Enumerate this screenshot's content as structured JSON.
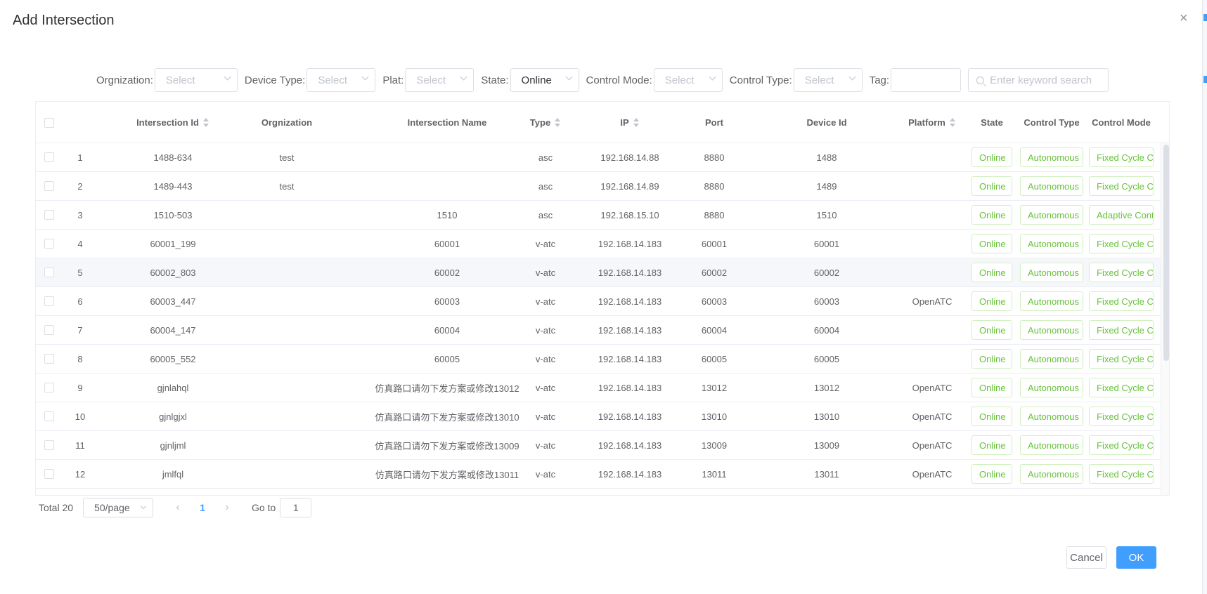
{
  "dialog": {
    "title": "Add Intersection",
    "close_icon": "close-icon",
    "close_glyph": "×"
  },
  "filters": {
    "organization": {
      "label": "Orgnization:",
      "placeholder": "Select"
    },
    "device_type": {
      "label": "Device Type:",
      "placeholder": "Select"
    },
    "plat": {
      "label": "Plat:",
      "placeholder": "Select"
    },
    "state": {
      "label": "State:",
      "value": "Online"
    },
    "control_mode": {
      "label": "Control Mode:",
      "placeholder": "Select"
    },
    "control_type": {
      "label": "Control Type:",
      "placeholder": "Select"
    },
    "tag": {
      "label": "Tag:",
      "value": ""
    },
    "search": {
      "placeholder": "Enter keyword search"
    }
  },
  "table": {
    "columns": {
      "intersection_id": "Intersection Id",
      "organization": "Orgnization",
      "intersection_name": "Intersection Name",
      "type": "Type",
      "ip": "IP",
      "port": "Port",
      "device_id": "Device Id",
      "platform": "Platform",
      "state": "State",
      "control_type": "Control Type",
      "control_mode": "Control Mode"
    },
    "rows": [
      {
        "index": "1",
        "intersection_id": "1488-634",
        "organization": "test",
        "intersection_name": "",
        "type": "asc",
        "ip": "192.168.14.88",
        "port": "8880",
        "device_id": "1488",
        "platform": "",
        "state": "Online",
        "control_type": "Autonomous",
        "control_mode": "Fixed Cycle Co"
      },
      {
        "index": "2",
        "intersection_id": "1489-443",
        "organization": "test",
        "intersection_name": "",
        "type": "asc",
        "ip": "192.168.14.89",
        "port": "8880",
        "device_id": "1489",
        "platform": "",
        "state": "Online",
        "control_type": "Autonomous",
        "control_mode": "Fixed Cycle Co"
      },
      {
        "index": "3",
        "intersection_id": "1510-503",
        "organization": "",
        "intersection_name": "1510",
        "type": "asc",
        "ip": "192.168.15.10",
        "port": "8880",
        "device_id": "1510",
        "platform": "",
        "state": "Online",
        "control_type": "Autonomous",
        "control_mode": "Adaptive Cont"
      },
      {
        "index": "4",
        "intersection_id": "60001_199",
        "organization": "",
        "intersection_name": "60001",
        "type": "v-atc",
        "ip": "192.168.14.183",
        "port": "60001",
        "device_id": "60001",
        "platform": "",
        "state": "Online",
        "control_type": "Autonomous",
        "control_mode": "Fixed Cycle Co"
      },
      {
        "index": "5",
        "intersection_id": "60002_803",
        "organization": "",
        "intersection_name": "60002",
        "type": "v-atc",
        "ip": "192.168.14.183",
        "port": "60002",
        "device_id": "60002",
        "platform": "",
        "state": "Online",
        "control_type": "Autonomous",
        "control_mode": "Fixed Cycle Co"
      },
      {
        "index": "6",
        "intersection_id": "60003_447",
        "organization": "",
        "intersection_name": "60003",
        "type": "v-atc",
        "ip": "192.168.14.183",
        "port": "60003",
        "device_id": "60003",
        "platform": "OpenATC",
        "state": "Online",
        "control_type": "Autonomous",
        "control_mode": "Fixed Cycle Co"
      },
      {
        "index": "7",
        "intersection_id": "60004_147",
        "organization": "",
        "intersection_name": "60004",
        "type": "v-atc",
        "ip": "192.168.14.183",
        "port": "60004",
        "device_id": "60004",
        "platform": "",
        "state": "Online",
        "control_type": "Autonomous",
        "control_mode": "Fixed Cycle Co"
      },
      {
        "index": "8",
        "intersection_id": "60005_552",
        "organization": "",
        "intersection_name": "60005",
        "type": "v-atc",
        "ip": "192.168.14.183",
        "port": "60005",
        "device_id": "60005",
        "platform": "",
        "state": "Online",
        "control_type": "Autonomous",
        "control_mode": "Fixed Cycle Co"
      },
      {
        "index": "9",
        "intersection_id": "gjnlahql",
        "organization": "",
        "intersection_name": "仿真路口请勿下发方案或修改13012",
        "type": "v-atc",
        "ip": "192.168.14.183",
        "port": "13012",
        "device_id": "13012",
        "platform": "OpenATC",
        "state": "Online",
        "control_type": "Autonomous",
        "control_mode": "Fixed Cycle Co"
      },
      {
        "index": "10",
        "intersection_id": "gjnlgjxl",
        "organization": "",
        "intersection_name": "仿真路口请勿下发方案或修改13010",
        "type": "v-atc",
        "ip": "192.168.14.183",
        "port": "13010",
        "device_id": "13010",
        "platform": "OpenATC",
        "state": "Online",
        "control_type": "Autonomous",
        "control_mode": "Fixed Cycle Co"
      },
      {
        "index": "11",
        "intersection_id": "gjnljml",
        "organization": "",
        "intersection_name": "仿真路口请勿下发方案或修改13009",
        "type": "v-atc",
        "ip": "192.168.14.183",
        "port": "13009",
        "device_id": "13009",
        "platform": "OpenATC",
        "state": "Online",
        "control_type": "Autonomous",
        "control_mode": "Fixed Cycle Co"
      },
      {
        "index": "12",
        "intersection_id": "jmlfql",
        "organization": "",
        "intersection_name": "仿真路口请勿下发方案或修改13011",
        "type": "v-atc",
        "ip": "192.168.14.183",
        "port": "13011",
        "device_id": "13011",
        "platform": "OpenATC",
        "state": "Online",
        "control_type": "Autonomous",
        "control_mode": "Fixed Cycle Co"
      }
    ]
  },
  "pagination": {
    "total": "Total 20",
    "page_size": "50/page",
    "prev_glyph": "‹",
    "current_page": "1",
    "next_glyph": "›",
    "goto_label": "Go to",
    "goto_value": "1"
  },
  "footer": {
    "cancel_label": "Cancel",
    "ok_label": "OK"
  },
  "colors": {
    "primary": "#409eff",
    "success": "#67c23a",
    "border": "#dcdfe6"
  }
}
